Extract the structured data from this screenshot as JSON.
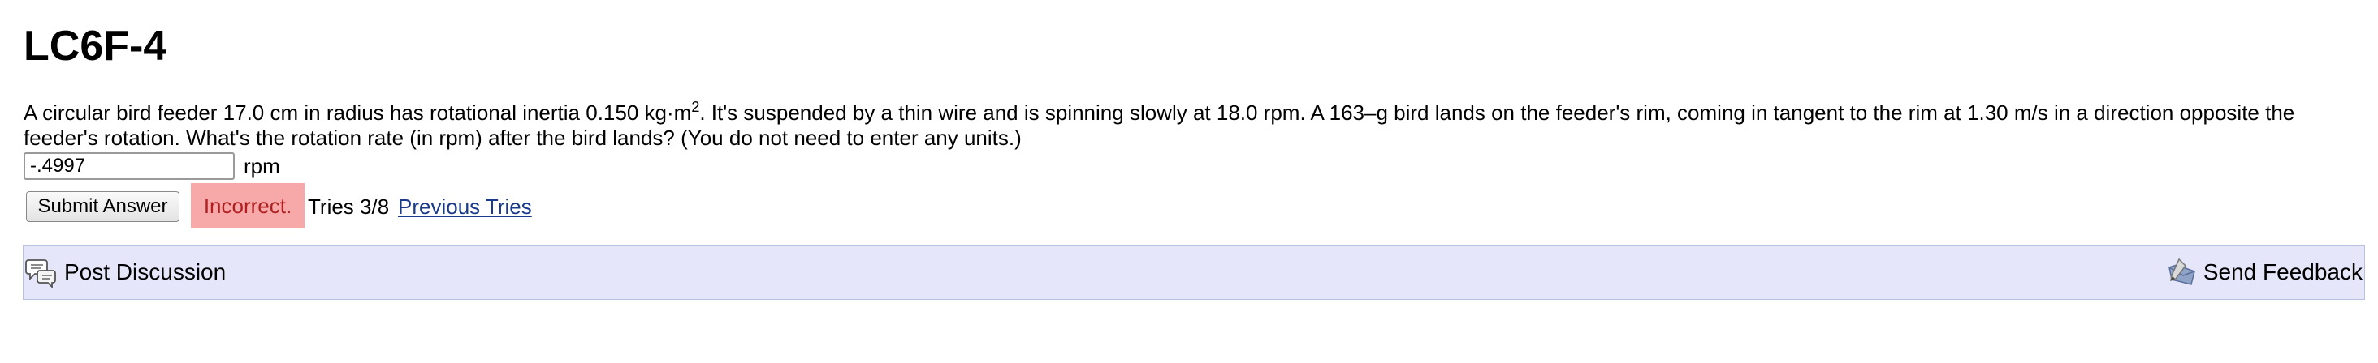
{
  "page": {
    "title": "LC6F-4"
  },
  "problem": {
    "text_before_sup": "A circular bird feeder 17.0 cm in radius has rotational inertia 0.150 kg·m",
    "sup": "2",
    "text_after_sup": ". It's suspended by a thin wire and is spinning slowly at 18.0 rpm. A 163–g bird lands on the feeder's rim, coming in tangent to the rim at 1.30 m/s in a direction opposite the feeder's rotation. What's the rotation rate (in rpm) after the bird lands? (You do not need to enter any units.)"
  },
  "answer": {
    "value": "-.4997",
    "unit": "rpm"
  },
  "submit": {
    "label": "Submit Answer"
  },
  "status": {
    "label": "Incorrect.",
    "color": "#f7a8a8"
  },
  "tries": {
    "label": "Tries 3/8",
    "link": "Previous Tries"
  },
  "footer": {
    "post_discussion": "Post Discussion",
    "send_feedback": "Send Feedback",
    "post_icon": "discussion-icon",
    "feedback_icon": "feedback-icon",
    "background": "#e6e6fa"
  }
}
